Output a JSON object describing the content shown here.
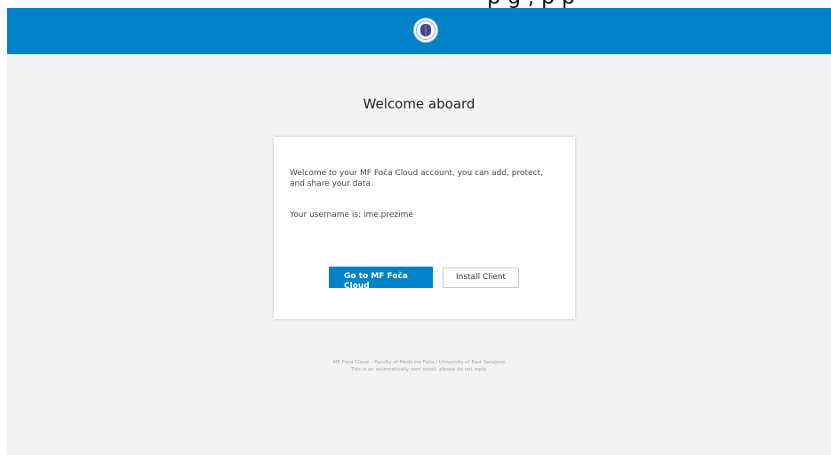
{
  "top_crop_text": "p       g  ,          p     p",
  "header": {
    "logo_icon": "university-seal-icon",
    "background_color": "#0082c9"
  },
  "title": "Welcome aboard",
  "card": {
    "message": "Welcome to your MF Foča Cloud account, you can add, protect, and share your data.",
    "username_line": "Your username is: ime.prezime",
    "primary_button": "Go to MF Foča Cloud",
    "secondary_button": "Install Client"
  },
  "footer": {
    "line1": "MF Foča Cloud – Faculty of Medicine Foča / University of East Sarajevo",
    "line2": "This is an automatically sent email, please do not reply."
  }
}
